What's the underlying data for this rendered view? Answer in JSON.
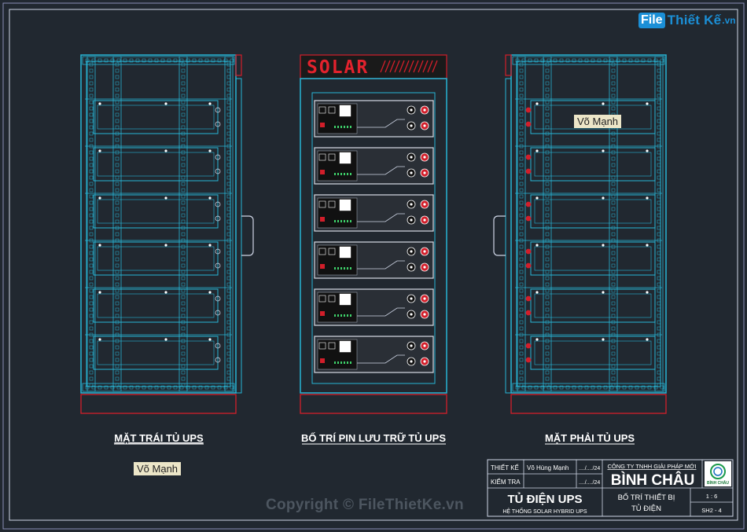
{
  "watermark_logo": {
    "box": "File",
    "text": "Thiết Kế",
    "suffix": ".vn"
  },
  "copyright": "Copyright © FileThietKe.vn",
  "views": {
    "left_title": "MẶT TRÁI TỦ UPS",
    "center_title": "BỐ TRÍ PIN LƯU TRỮ TỦ UPS",
    "right_title": "MẶT PHẢI TỦ UPS"
  },
  "cabinet_sign": "SOLAR",
  "author_tags": [
    "Võ Mạnh",
    "Võ Mạnh"
  ],
  "title_block": {
    "designed_label": "THIẾT KẾ",
    "designed_name": "Võ Hùng Mạnh",
    "designed_date": "..../..../24",
    "checked_label": "KIỂM TRA",
    "checked_date": "..../..../24",
    "company_line": "CÔNG TY TNHH GIẢI PHÁP MỚI",
    "company_name": "BÌNH CHÂU",
    "logo_caption": "BÌNH CHÂU",
    "project_title": "TỦ ĐIỆN UPS",
    "project_subtitle": "HỆ THỐNG SOLAR HYBRID UPS",
    "sheet_title_1": "BỐ TRÍ THIẾT BỊ",
    "sheet_title_2": "TỦ ĐIỆN",
    "scale": "1 : 6",
    "sheet_no": "SH2 - 4"
  },
  "colors": {
    "background": "#212830",
    "frame": "#cfd6e6",
    "cyan": "#27b6d6",
    "red": "#d21e2a",
    "white": "#ffffff"
  }
}
